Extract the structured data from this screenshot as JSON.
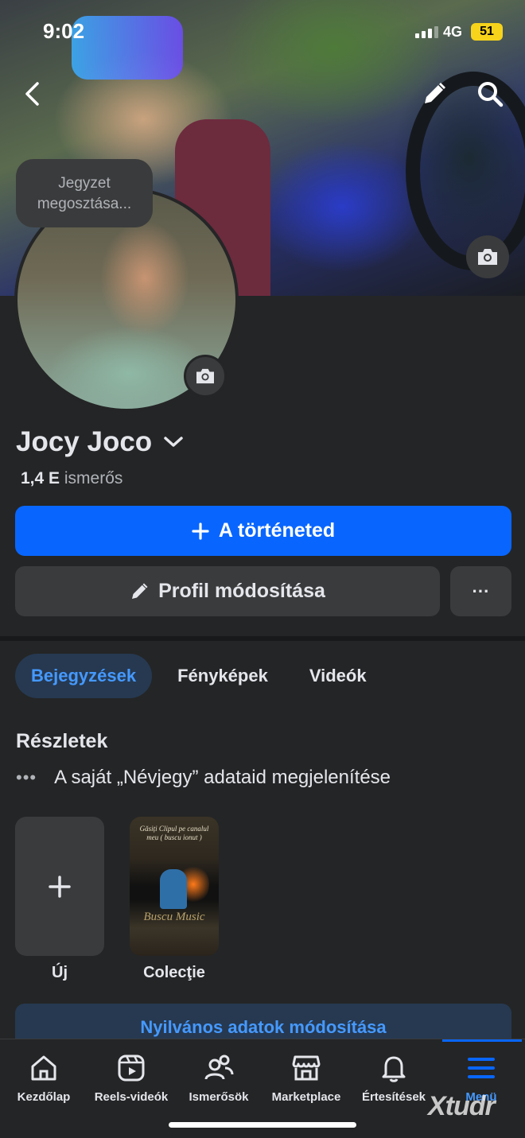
{
  "status": {
    "time": "9:02",
    "network": "4G",
    "battery": "51"
  },
  "cover": {
    "back_icon": "chevron-left-icon",
    "edit_icon": "pencil-icon",
    "search_icon": "search-icon",
    "camera_icon": "camera-icon"
  },
  "note": {
    "text": "Jegyzet megosztása..."
  },
  "profile": {
    "name": "Jocy Joco",
    "friends_count": "1,4 E",
    "friends_label": "ismerős"
  },
  "actions": {
    "story_label": "A történeted",
    "edit_profile_label": "Profil módosítása",
    "more_label": "···"
  },
  "tabs": [
    {
      "label": "Bejegyzések",
      "active": true
    },
    {
      "label": "Fényképek",
      "active": false
    },
    {
      "label": "Videók",
      "active": false
    }
  ],
  "details": {
    "title": "Részletek",
    "about_text": "A saját „Névjegy” adataid megjelenítése"
  },
  "highlights": [
    {
      "label": "Új"
    },
    {
      "label": "Colecţie",
      "caption": "Găsiți Clipul pe canalul meu ( buscu ionut )",
      "artwork_text": "Buscu Music"
    }
  ],
  "public_details_button": "Nyilvános adatok módosítása",
  "bottom_nav": [
    {
      "label": "Kezdőlap",
      "icon": "home-icon"
    },
    {
      "label": "Reels-videók",
      "icon": "reels-icon"
    },
    {
      "label": "Ismerősök",
      "icon": "friends-icon"
    },
    {
      "label": "Marketplace",
      "icon": "marketplace-icon"
    },
    {
      "label": "Értesítések",
      "icon": "bell-icon"
    },
    {
      "label": "Menü",
      "icon": "menu-icon",
      "active": true
    }
  ],
  "watermark": "Xtudr",
  "colors": {
    "accent": "#0866ff",
    "background": "#242526",
    "surface": "#3a3b3c",
    "active_tab_bg": "#263951",
    "active_text": "#4599ff"
  }
}
